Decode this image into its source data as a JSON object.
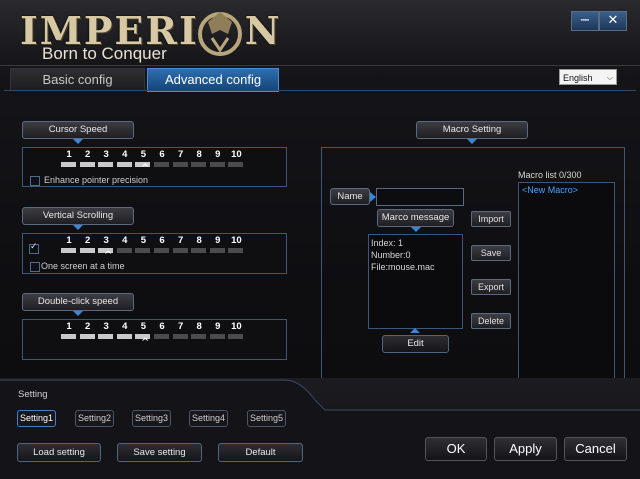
{
  "brand": {
    "name": "IMPERI",
    "name_end": "N",
    "tagline": "Born to Conquer"
  },
  "window": {
    "minimize": "−",
    "close": "✕"
  },
  "tabs": {
    "basic": "Basic config",
    "advanced": "Advanced config"
  },
  "language": {
    "selected": "English",
    "arrow": "⌵"
  },
  "cursor_speed": {
    "label": "Cursor Speed",
    "levels": [
      "1",
      "2",
      "3",
      "4",
      "5",
      "6",
      "7",
      "8",
      "9",
      "10"
    ],
    "selected": 5,
    "caret": "^",
    "checkbox_label": "Enhance pointer precision",
    "checked": false
  },
  "vertical_scrolling": {
    "label": "Vertical Scrolling",
    "levels": [
      "1",
      "2",
      "3",
      "4",
      "5",
      "6",
      "7",
      "8",
      "9",
      "10"
    ],
    "selected": 3,
    "caret": "^",
    "enabled": true,
    "checkbox_label": "One screen at a time",
    "one_screen": false
  },
  "double_click": {
    "label": "Double-click speed",
    "levels": [
      "1",
      "2",
      "3",
      "4",
      "5",
      "6",
      "7",
      "8",
      "9",
      "10"
    ],
    "selected": 5,
    "caret": "^"
  },
  "macro": {
    "title": "Macro Setting",
    "name_label": "Name",
    "name_value": "",
    "message_label": "Marco message",
    "info": [
      "Index: 1",
      "Number:0",
      "File:mouse.mac"
    ],
    "edit_label": "Edit",
    "buttons": {
      "import": "Import",
      "save": "Save",
      "export": "Export",
      "delete": "Delete"
    },
    "list_title": "Macro list 0/300",
    "list_items": [
      "<New Macro>"
    ]
  },
  "setting": {
    "title": "Setting",
    "tabs": [
      "Setting1",
      "Setting2",
      "Setting3",
      "Setting4",
      "Setting5"
    ],
    "active_index": 0,
    "load": "Load setting",
    "save": "Save setting",
    "default": "Default"
  },
  "dialog": {
    "ok": "OK",
    "apply": "Apply",
    "cancel": "Cancel"
  },
  "colors": {
    "accent": "#2e6fb0",
    "triangle": "#3b86d6",
    "list_text": "#4fa0ff",
    "brand_gold": "#d8c9a5"
  }
}
